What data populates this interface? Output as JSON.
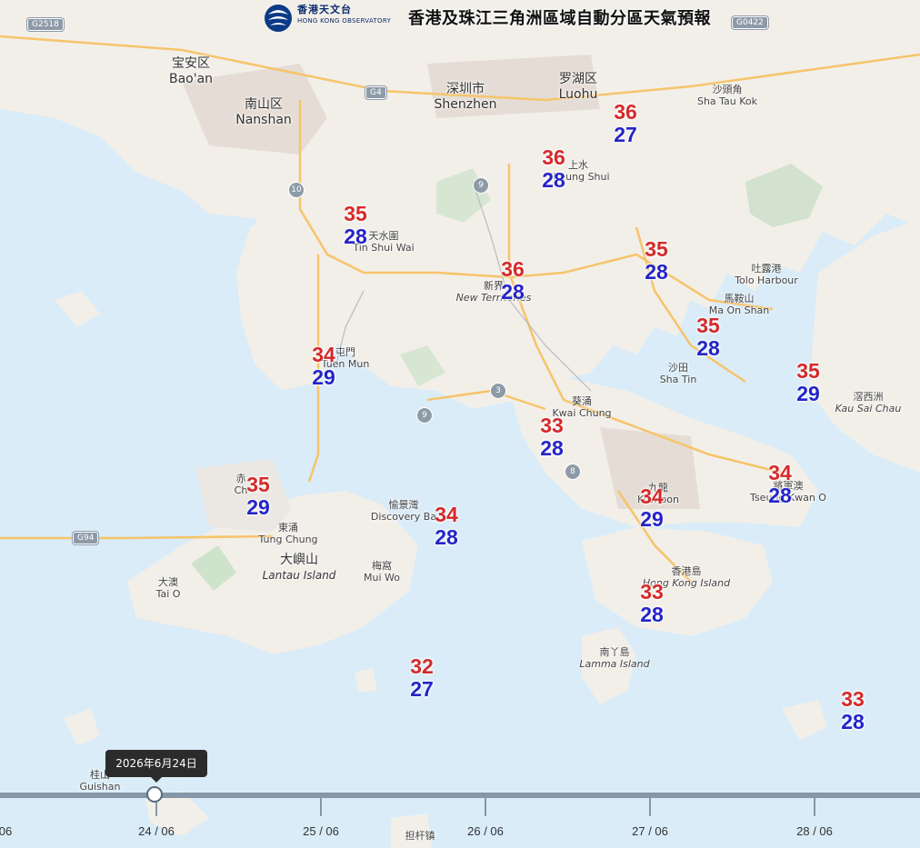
{
  "header": {
    "logo_zh": "香港天文台",
    "logo_en": "HONG KONG OBSERVATORY",
    "title": "香港及珠江三角洲區域自動分區天氣預報"
  },
  "colors": {
    "sea": "#d9ecf8",
    "land": "#f2efe9",
    "high_temp": "#d42a2a",
    "low_temp": "#2424c8",
    "road": "#f6c46a"
  },
  "road_shields": [
    "G2518",
    "G0422",
    "G4",
    "G94"
  ],
  "route_numbers": [
    "10",
    "9",
    "3",
    "9",
    "8"
  ],
  "places": {
    "baoan": {
      "zh": "宝安区",
      "en": "Bao'an"
    },
    "nanshan": {
      "zh": "南山区",
      "en": "Nanshan"
    },
    "shenzhen": {
      "zh": "深圳市",
      "en": "Shenzhen"
    },
    "luohu": {
      "zh": "罗湖区",
      "en": "Luohu"
    },
    "shataukok": {
      "zh": "沙頭角",
      "en": "Sha Tau Kok"
    },
    "sheungshui": {
      "zh": "上水",
      "en": "Sheung Shui"
    },
    "tinshuiwai": {
      "zh": "天水圍",
      "en": "Tin Shui Wai"
    },
    "newterritories": {
      "zh": "新界",
      "en": "New Territories"
    },
    "tolo": {
      "zh": "吐露港",
      "en": "Tolo Harbour"
    },
    "maonshan": {
      "zh": "馬鞍山",
      "en": "Ma On Shan"
    },
    "tuenmun": {
      "zh": "屯門",
      "en": "Tuen Mun"
    },
    "shatin": {
      "zh": "沙田",
      "en": "Sha Tin"
    },
    "kwaichung": {
      "zh": "葵涌",
      "en": "Kwai Chung"
    },
    "kausaichau": {
      "zh": "滘西洲",
      "en": "Kau Sai Chau"
    },
    "chek": {
      "zh": "赤",
      "en": "Ch"
    },
    "tungchung": {
      "zh": "東涌",
      "en": "Tung Chung"
    },
    "discovery": {
      "zh": "愉景灣",
      "en": "Discovery Ba"
    },
    "lantau": {
      "zh": "大嶼山",
      "en": "Lantau Island"
    },
    "muiwo": {
      "zh": "梅窩",
      "en": "Mui Wo"
    },
    "taio": {
      "zh": "大澳",
      "en": "Tai O"
    },
    "kowloon": {
      "zh": "九龍",
      "en": "Kowloon"
    },
    "tseungkwano": {
      "zh": "將軍澳",
      "en": "Tseung Kwan O"
    },
    "hkisland": {
      "zh": "香港島",
      "en": "Hong Kong Island"
    },
    "lamma": {
      "zh": "南丫島",
      "en": "Lamma Island"
    },
    "guishan": {
      "zh": "桂山",
      "en": "Guishan"
    },
    "danganzhen": {
      "zh": "担杆镇",
      "en": ""
    }
  },
  "stations": [
    {
      "high": 36,
      "low": 27
    },
    {
      "high": 36,
      "low": 28
    },
    {
      "high": 35,
      "low": 28
    },
    {
      "high": 36,
      "low": 28
    },
    {
      "high": 35,
      "low": 28
    },
    {
      "high": 35,
      "low": 28
    },
    {
      "high": 34,
      "low": 29
    },
    {
      "high": 35,
      "low": 29
    },
    {
      "high": 33,
      "low": 28
    },
    {
      "high": 34,
      "low": 28
    },
    {
      "high": 35,
      "low": 29
    },
    {
      "high": 34,
      "low": 28
    },
    {
      "high": 34,
      "low": 29
    },
    {
      "high": 33,
      "low": 28
    },
    {
      "high": 32,
      "low": 27
    },
    {
      "high": 33,
      "low": 28
    }
  ],
  "timeline": {
    "ticks": [
      "06",
      "24 / 06",
      "25 / 06",
      "26 / 06",
      "27 / 06",
      "28 / 06"
    ],
    "tooltip": "2026年6月24日",
    "selected_day": "24 / 06"
  }
}
